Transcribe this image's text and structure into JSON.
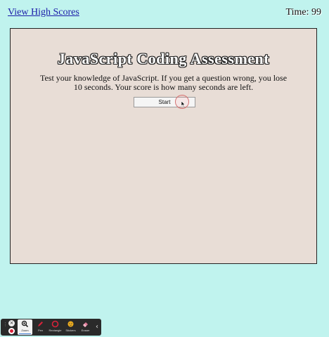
{
  "header": {
    "high_scores_link": "View High Scores",
    "timer_text": "Time: 99"
  },
  "quiz": {
    "title": "JavaScript Coding Assessment",
    "description": "Test your knowledge of JavaScript. If you get a question wrong, you lose 10 seconds. Your score is how many seconds are left.",
    "start_button_label": "Start"
  },
  "annotation_toolbar": {
    "close_glyph": "×",
    "tools": [
      {
        "label": "Zoom",
        "icon": "magnifier-icon"
      },
      {
        "label": "Pen",
        "icon": "pen-icon"
      },
      {
        "label": "Rectangle",
        "icon": "rectangle-icon"
      },
      {
        "label": "Stickers",
        "icon": "sticker-icon"
      },
      {
        "label": "Eraser",
        "icon": "eraser-icon"
      }
    ],
    "collapse_glyph": "‹"
  },
  "colors": {
    "page_background": "#c0f3ee",
    "quiz_background": "#e8ddd6",
    "link": "#1a1aa8",
    "click_highlight": "#d47272"
  }
}
